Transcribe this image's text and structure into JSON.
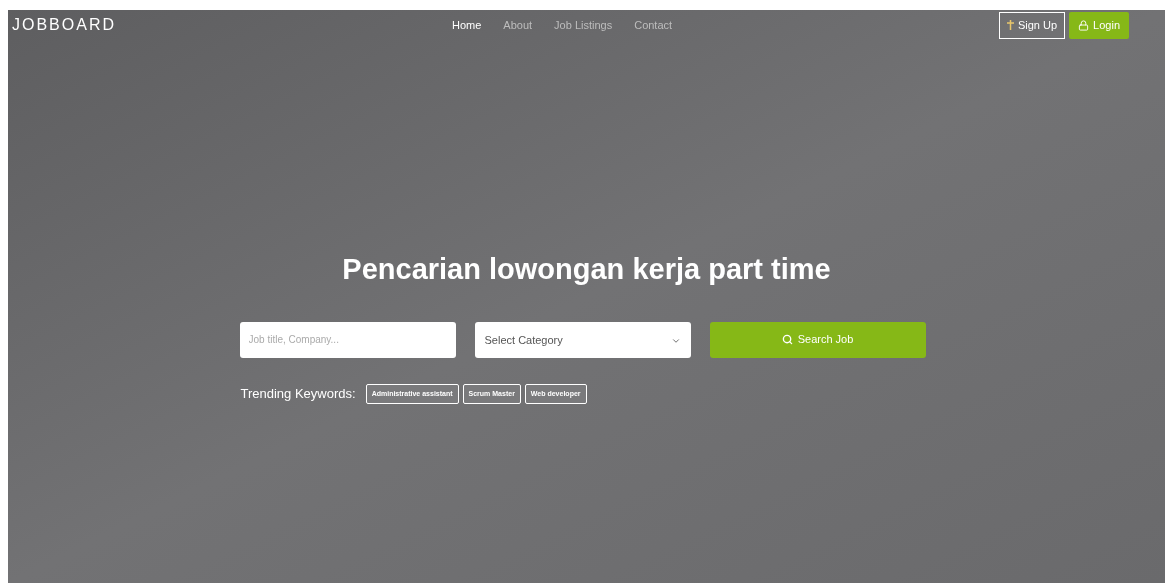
{
  "brand": "JOBBOARD",
  "nav": [
    {
      "label": "Home",
      "selected": true
    },
    {
      "label": "About",
      "selected": false
    },
    {
      "label": "Job Listings",
      "selected": false
    },
    {
      "label": "Contact",
      "selected": false
    }
  ],
  "auth": {
    "signup": "Sign Up",
    "login": "Login"
  },
  "hero": {
    "title": "Pencarian lowongan kerja part time",
    "search": {
      "placeholder": "Job title, Company...",
      "category": "Select Category",
      "button": "Search Job"
    },
    "trending": {
      "label": "Trending Keywords:",
      "keywords": [
        "Administrative assistant",
        "Scrum Master",
        "Web developer"
      ]
    }
  }
}
